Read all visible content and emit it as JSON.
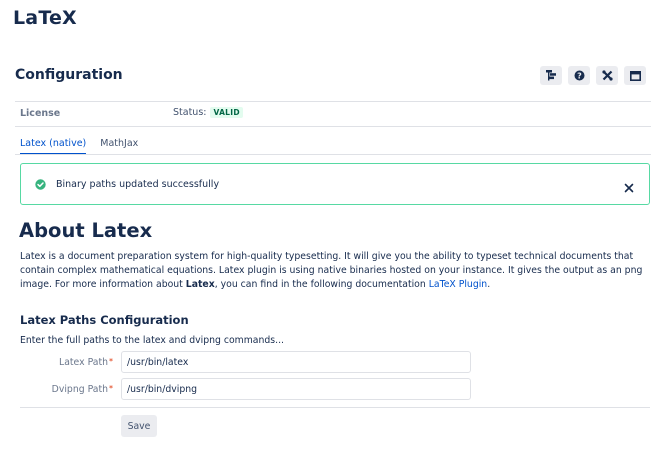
{
  "app": {
    "title": "LaTeX"
  },
  "header": {
    "section_title": "Configuration",
    "toolbar_icons": [
      "hierarchy-icon",
      "help-icon",
      "tools-icon",
      "window-icon"
    ]
  },
  "license": {
    "label": "License",
    "status_label": "Status:",
    "status_value": "VALID"
  },
  "tabs": [
    {
      "label": "Latex (native)",
      "active": true
    },
    {
      "label": "MathJax",
      "active": false
    }
  ],
  "alert": {
    "message": "Binary paths updated successfully",
    "icon": "check-circle-icon",
    "close_icon": "close-icon"
  },
  "about": {
    "title": "About Latex",
    "text_part1": "Latex is a document preparation system for high-quality typesetting. It will give you the ability to typeset technical documents that contain complex mathematical equations. Latex plugin is using native binaries hosted on your instance. It gives the output as an png image. For more information about ",
    "text_bold": "Latex",
    "text_part2": ", you can find in the following documentation ",
    "link_text": "LaTeX Plugin",
    "text_end": "."
  },
  "paths": {
    "title": "Latex Paths Configuration",
    "description": "Enter the full paths to the latex and dvipng commands...",
    "fields": [
      {
        "label": "Latex Path",
        "value": "/usr/bin/latex",
        "required": true
      },
      {
        "label": "Dvipng Path",
        "value": "/usr/bin/dvipng",
        "required": true
      }
    ],
    "save_label": "Save"
  },
  "colors": {
    "accent": "#0052cc",
    "success": "#36b37e",
    "valid_badge_bg": "#e3fcef",
    "valid_badge_text": "#006644",
    "required": "#de350b"
  }
}
